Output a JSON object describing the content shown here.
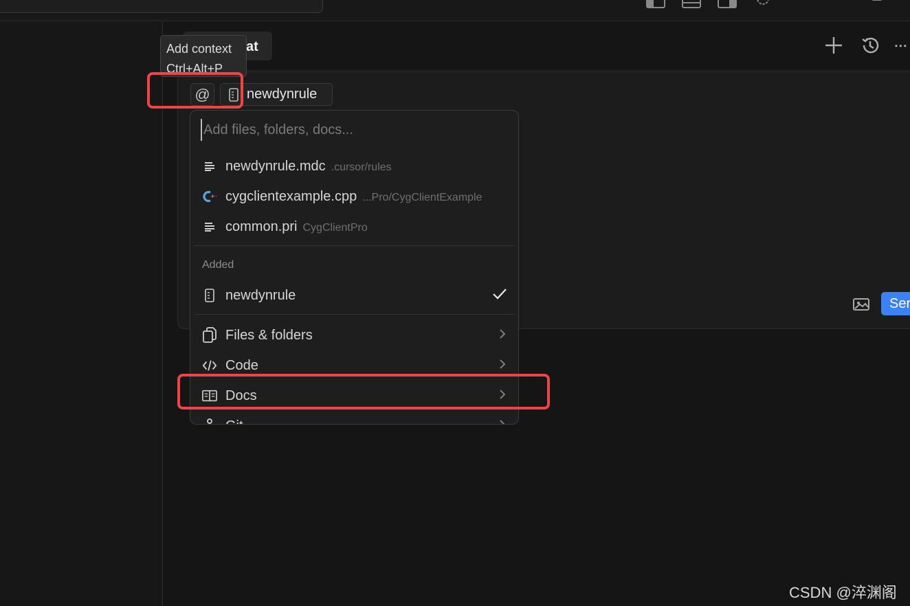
{
  "tooltip": {
    "title": "Add context",
    "shortcut": "Ctrl+Alt+P"
  },
  "chat_header": {
    "tab_label": "at",
    "new_chat_icon": "plus-icon",
    "history_icon": "history-icon",
    "more_icon": "ellipsis-icon"
  },
  "context": {
    "at_symbol": "@",
    "chip_label": "newdynrule"
  },
  "dropdown": {
    "search_placeholder": "Add files, folders, docs...",
    "recent": [
      {
        "name": "newdynrule.mdc",
        "path": ".cursor/rules",
        "icon": "lines-file-icon"
      },
      {
        "name": "cygclientexample.cpp",
        "path": "...Pro/CygClientExample",
        "icon": "cpp-file-icon"
      },
      {
        "name": "common.pri",
        "path": "CygClientPro",
        "icon": "lines-file-icon"
      }
    ],
    "added_label": "Added",
    "added": [
      {
        "name": "newdynrule",
        "icon": "rule-icon",
        "checked": true
      }
    ],
    "categories": [
      {
        "name": "Files & folders",
        "icon": "files-icon"
      },
      {
        "name": "Code",
        "icon": "code-icon"
      },
      {
        "name": "Docs",
        "icon": "book-icon"
      },
      {
        "name": "Git",
        "icon": "git-icon"
      }
    ]
  },
  "composer": {
    "send_label": "Ser"
  },
  "watermark": "CSDN @淬渊阁",
  "colors": {
    "accent": "#3b82f6",
    "highlight": "#ef4444",
    "background": "#151515"
  }
}
